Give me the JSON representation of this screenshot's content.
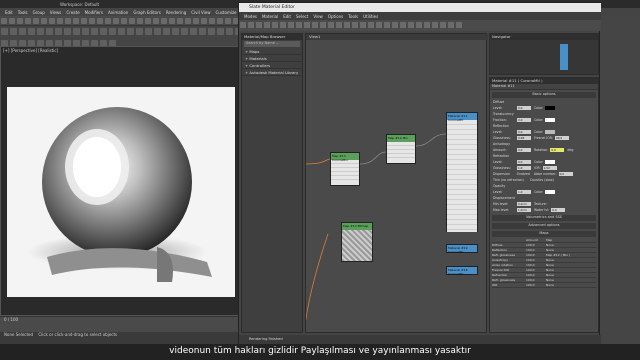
{
  "app": {
    "title_left": "Workspace: Default",
    "title_center": "Autodesk 3ds Max 2016",
    "file_name": "materialsj.max",
    "menu": [
      "Edit",
      "Tools",
      "Group",
      "Views",
      "Create",
      "Modifiers",
      "Animation",
      "Graph Editors",
      "Rendering",
      "Civil View",
      "Customize",
      "Scripting",
      "Content",
      "Help"
    ]
  },
  "viewport": {
    "label": "[+] [Perspective] [Realistic]"
  },
  "timeline": {
    "frame": "0 / 100"
  },
  "status": {
    "selection": "None Selected",
    "prompt": "Click or click-and-drag to select objects"
  },
  "slate": {
    "title": "Slate Material Editor",
    "menu": [
      "Modes",
      "Material",
      "Edit",
      "Select",
      "View",
      "Options",
      "Tools",
      "Utilities"
    ],
    "browser_title": "Material/Map Browser",
    "search_placeholder": "Search by Name ...",
    "browser_items": [
      "+ Maps",
      "+ Materials",
      "+ Controllers",
      "+ Autodesk Material Library"
    ],
    "view_tab": "View1",
    "navigator_title": "Navigator",
    "param_title": "Material #11  ( CoronaMtl )",
    "param_sub": "Material #11",
    "basic_options": "Basic options",
    "diffuse_label": "Diffuse",
    "level_label": "Level:",
    "level_value": "0,0",
    "color_label": "Color:",
    "translucency_label": "Translucency",
    "fraction_label": "Fraction:",
    "fraction_value": "0,0",
    "reflection_label": "Reflection",
    "reflection_level": "0,0",
    "glossiness_label": "Glossiness:",
    "glossiness_value": "0,98",
    "fresnel_label": "Fresnel IOR:",
    "fresnel_value": "99,0",
    "anisotropy_label": "Anisotropy",
    "amount_label": "Amount:",
    "amount_value": "0,0",
    "rotation_label": "Rotation:",
    "rotation_value": "0,0",
    "deg_label": "deg",
    "refraction_label": "Refraction",
    "refr_level": "0,0",
    "refr_gloss": "1,0",
    "ior_label": "IOR:",
    "ior_value": "1,52",
    "dispersion_label": "Dispersion",
    "enabled_label": "Enabled",
    "abbe_label": "Abbe number:",
    "abbe_value": "0,0",
    "thin_label": "Thin (no refraction)",
    "caustics_label": "Caustics (slow)",
    "opacity_label": "Opacity",
    "opacity_level": "1,0",
    "displacement_label": "Displacement",
    "min_level_label": "Min level:",
    "min_level_value": "0,0cm",
    "max_level_label": "Max level:",
    "max_level_value": "1,0cm",
    "texture_label": "Texture:",
    "water_label": "Water lvl:",
    "water_value": "0,0",
    "volumetrics": "Volumetrics and SSS",
    "advanced": "Advanced options",
    "maps_title": "Maps",
    "maps_header": [
      "Amount",
      "Map"
    ],
    "maps": [
      {
        "name": "Diffuse",
        "amount": "100,0",
        "map": "None"
      },
      {
        "name": "Reflection",
        "amount": "100,0",
        "map": "None"
      },
      {
        "name": "Refl. glossiness",
        "amount": "100,0",
        "map": "Map #12 ( Mix )"
      },
      {
        "name": "Anisotropy",
        "amount": "100,0",
        "map": "None"
      },
      {
        "name": "Aniso rotation",
        "amount": "100,0",
        "map": "None"
      },
      {
        "name": "Fresnel IOR",
        "amount": "100,0",
        "map": "None"
      },
      {
        "name": "Refraction",
        "amount": "100,0",
        "map": "None"
      },
      {
        "name": "Refr. glossiness",
        "amount": "100,0",
        "map": "None"
      },
      {
        "name": "IOR",
        "amount": "100,0",
        "map": "None"
      }
    ],
    "status_text": "Rendering finished",
    "nodes": {
      "mix_title": "Map #12",
      "mix_sub": "Mix",
      "mix2_title": "Map #13",
      "mix2_sub": "CoronaMix",
      "mtl_title": "Material #11",
      "mtl_sub": "CoronaMtl",
      "tex_title": "Map #14",
      "tex_sub": "Bitmap",
      "mtl2_title": "Material #19",
      "mtl2_sub": "CoronaMtl",
      "mtl3_title": "Material #18",
      "mtl3_sub": "CoronaMtl"
    },
    "panel_name": "View1"
  },
  "subtitle": "videonun tüm hakları gizlidir Paylaşılması ve yayınlanması yasaktır",
  "colors": {
    "node_green": "#5aa05a",
    "node_blue": "#4a90c8",
    "wire_orange": "#e07a3a"
  }
}
